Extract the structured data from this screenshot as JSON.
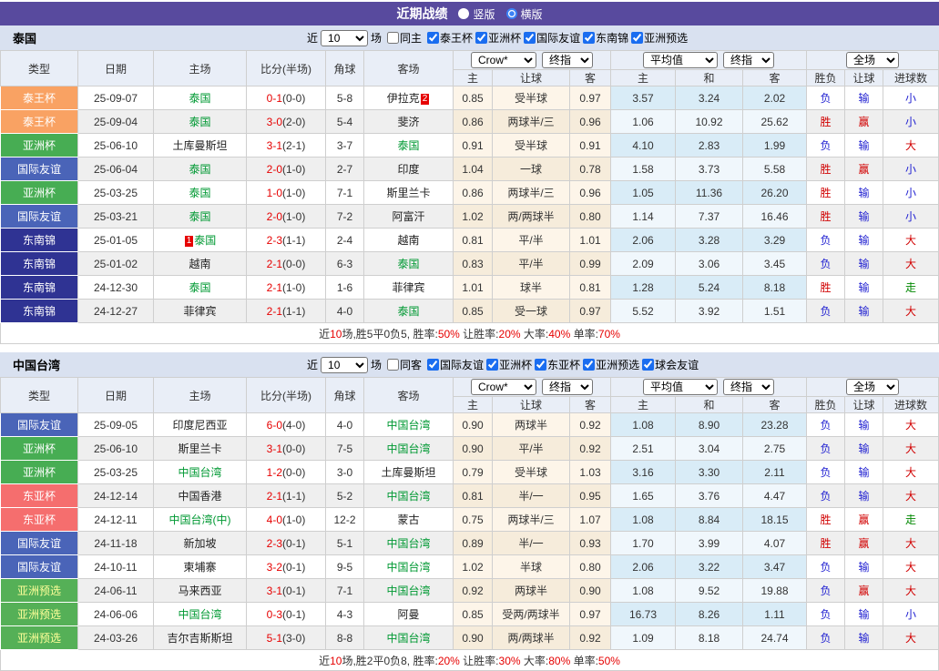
{
  "title_bar": {
    "title": "近期战绩",
    "options": [
      {
        "label": "竖版",
        "selected": false
      },
      {
        "label": "横版",
        "selected": true
      }
    ]
  },
  "table_header": {
    "left_cols": [
      "类型",
      "日期",
      "主场",
      "比分(半场)",
      "角球",
      "客场"
    ],
    "sub_cols": [
      "主",
      "让球",
      "客",
      "主",
      "和",
      "客",
      "胜负",
      "让球",
      "进球数"
    ],
    "odds_group": {
      "source_select": "Crow*",
      "time_select": "终指"
    },
    "avg_group": {
      "source_select": "平均值",
      "time_select": "终指"
    },
    "result_group": {
      "scope_select": "全场"
    }
  },
  "type_styles": {
    "泰王杯": {
      "bg": "#f9a263",
      "fg": "#ffffff"
    },
    "亚洲杯": {
      "bg": "#47ad53",
      "fg": "#ffffff"
    },
    "国际友谊": {
      "bg": "#4a64b8",
      "fg": "#ffffff"
    },
    "东南锦": {
      "bg": "#2f3393",
      "fg": "#ffffff"
    },
    "东亚杯": {
      "bg": "#f56e6e",
      "fg": "#ffffff"
    },
    "亚洲预选": {
      "bg": "#55b057",
      "fg": "#ffff99"
    }
  },
  "result_colors": {
    "胜": "#d10000",
    "负": "#1f1fd1",
    "赢": "#d10000",
    "输": "#1f1fd1",
    "大": "#d10000",
    "小": "#1f1fd1",
    "走": "#008800"
  },
  "sections": [
    {
      "team": "泰国",
      "filter": {
        "near_label": "近",
        "count": "10",
        "games_label": "场",
        "same_label": "同主",
        "same_checked": false,
        "competitions": [
          {
            "label": "泰王杯",
            "checked": true
          },
          {
            "label": "亚洲杯",
            "checked": true
          },
          {
            "label": "国际友谊",
            "checked": true
          },
          {
            "label": "东南锦",
            "checked": true
          },
          {
            "label": "亚洲预选",
            "checked": true
          }
        ]
      },
      "rows": [
        {
          "type": "泰王杯",
          "date": "25-09-07",
          "home": {
            "name": "泰国",
            "green": true
          },
          "score": "0-1",
          "half": "(0-0)",
          "corners": "5-8",
          "away": {
            "name": "伊拉克",
            "green": false,
            "badge": "2",
            "badge_pos": "after"
          },
          "odds": {
            "home": "0.85",
            "line": "受半球",
            "away": "0.97"
          },
          "avg": {
            "home": "3.57",
            "draw": "3.24",
            "away": "2.02"
          },
          "result": {
            "outcome": "负",
            "handicap": "输",
            "goals": "小"
          }
        },
        {
          "type": "泰王杯",
          "date": "25-09-04",
          "home": {
            "name": "泰国",
            "green": true
          },
          "score": "3-0",
          "half": "(2-0)",
          "corners": "5-4",
          "away": {
            "name": "斐济",
            "green": false
          },
          "odds": {
            "home": "0.86",
            "line": "两球半/三",
            "away": "0.96"
          },
          "avg": {
            "home": "1.06",
            "draw": "10.92",
            "away": "25.62"
          },
          "result": {
            "outcome": "胜",
            "handicap": "赢",
            "goals": "小"
          }
        },
        {
          "type": "亚洲杯",
          "date": "25-06-10",
          "home": {
            "name": "土库曼斯坦",
            "green": false
          },
          "score": "3-1",
          "half": "(2-1)",
          "corners": "3-7",
          "away": {
            "name": "泰国",
            "green": true
          },
          "odds": {
            "home": "0.91",
            "line": "受半球",
            "away": "0.91"
          },
          "avg": {
            "home": "4.10",
            "draw": "2.83",
            "away": "1.99"
          },
          "result": {
            "outcome": "负",
            "handicap": "输",
            "goals": "大"
          }
        },
        {
          "type": "国际友谊",
          "date": "25-06-04",
          "home": {
            "name": "泰国",
            "green": true
          },
          "score": "2-0",
          "half": "(1-0)",
          "corners": "2-7",
          "away": {
            "name": "印度",
            "green": false
          },
          "odds": {
            "home": "1.04",
            "line": "一球",
            "away": "0.78"
          },
          "avg": {
            "home": "1.58",
            "draw": "3.73",
            "away": "5.58"
          },
          "result": {
            "outcome": "胜",
            "handicap": "赢",
            "goals": "小"
          }
        },
        {
          "type": "亚洲杯",
          "date": "25-03-25",
          "home": {
            "name": "泰国",
            "green": true
          },
          "score": "1-0",
          "half": "(1-0)",
          "corners": "7-1",
          "away": {
            "name": "斯里兰卡",
            "green": false
          },
          "odds": {
            "home": "0.86",
            "line": "两球半/三",
            "away": "0.96"
          },
          "avg": {
            "home": "1.05",
            "draw": "11.36",
            "away": "26.20"
          },
          "result": {
            "outcome": "胜",
            "handicap": "输",
            "goals": "小"
          }
        },
        {
          "type": "国际友谊",
          "date": "25-03-21",
          "home": {
            "name": "泰国",
            "green": true
          },
          "score": "2-0",
          "half": "(1-0)",
          "corners": "7-2",
          "away": {
            "name": "阿富汗",
            "green": false
          },
          "odds": {
            "home": "1.02",
            "line": "两/两球半",
            "away": "0.80"
          },
          "avg": {
            "home": "1.14",
            "draw": "7.37",
            "away": "16.46"
          },
          "result": {
            "outcome": "胜",
            "handicap": "输",
            "goals": "小"
          }
        },
        {
          "type": "东南锦",
          "date": "25-01-05",
          "home": {
            "name": "泰国",
            "green": true,
            "badge": "1",
            "badge_pos": "before"
          },
          "score": "2-3",
          "half": "(1-1)",
          "corners": "2-4",
          "away": {
            "name": "越南",
            "green": false
          },
          "odds": {
            "home": "0.81",
            "line": "平/半",
            "away": "1.01"
          },
          "avg": {
            "home": "2.06",
            "draw": "3.28",
            "away": "3.29"
          },
          "result": {
            "outcome": "负",
            "handicap": "输",
            "goals": "大"
          }
        },
        {
          "type": "东南锦",
          "date": "25-01-02",
          "home": {
            "name": "越南",
            "green": false
          },
          "score": "2-1",
          "half": "(0-0)",
          "corners": "6-3",
          "away": {
            "name": "泰国",
            "green": true
          },
          "odds": {
            "home": "0.83",
            "line": "平/半",
            "away": "0.99"
          },
          "avg": {
            "home": "2.09",
            "draw": "3.06",
            "away": "3.45"
          },
          "result": {
            "outcome": "负",
            "handicap": "输",
            "goals": "大"
          }
        },
        {
          "type": "东南锦",
          "date": "24-12-30",
          "home": {
            "name": "泰国",
            "green": true
          },
          "score": "2-1",
          "half": "(1-0)",
          "corners": "1-6",
          "away": {
            "name": "菲律宾",
            "green": false
          },
          "odds": {
            "home": "1.01",
            "line": "球半",
            "away": "0.81"
          },
          "avg": {
            "home": "1.28",
            "draw": "5.24",
            "away": "8.18"
          },
          "result": {
            "outcome": "胜",
            "handicap": "输",
            "goals": "走"
          }
        },
        {
          "type": "东南锦",
          "date": "24-12-27",
          "home": {
            "name": "菲律宾",
            "green": false
          },
          "score": "2-1",
          "half": "(1-1)",
          "corners": "4-0",
          "away": {
            "name": "泰国",
            "green": true
          },
          "odds": {
            "home": "0.85",
            "line": "受一球",
            "away": "0.97"
          },
          "avg": {
            "home": "5.52",
            "draw": "3.92",
            "away": "1.51"
          },
          "result": {
            "outcome": "负",
            "handicap": "输",
            "goals": "大"
          }
        }
      ],
      "summary": [
        {
          "text": "近",
          "red": false
        },
        {
          "text": "10",
          "red": true
        },
        {
          "text": "场,胜5平0负5, 胜率:",
          "red": false
        },
        {
          "text": "50%",
          "red": true
        },
        {
          "text": " 让胜率:",
          "red": false
        },
        {
          "text": "20%",
          "red": true
        },
        {
          "text": " 大率:",
          "red": false
        },
        {
          "text": "40%",
          "red": true
        },
        {
          "text": " 单率:",
          "red": false
        },
        {
          "text": "70%",
          "red": true
        }
      ]
    },
    {
      "team": "中国台湾",
      "filter": {
        "near_label": "近",
        "count": "10",
        "games_label": "场",
        "same_label": "同客",
        "same_checked": false,
        "competitions": [
          {
            "label": "国际友谊",
            "checked": true
          },
          {
            "label": "亚洲杯",
            "checked": true
          },
          {
            "label": "东亚杯",
            "checked": true
          },
          {
            "label": "亚洲预选",
            "checked": true
          },
          {
            "label": "球会友谊",
            "checked": true
          }
        ]
      },
      "rows": [
        {
          "type": "国际友谊",
          "date": "25-09-05",
          "home": {
            "name": "印度尼西亚",
            "green": false
          },
          "score": "6-0",
          "half": "(4-0)",
          "corners": "4-0",
          "away": {
            "name": "中国台湾",
            "green": true
          },
          "odds": {
            "home": "0.90",
            "line": "两球半",
            "away": "0.92"
          },
          "avg": {
            "home": "1.08",
            "draw": "8.90",
            "away": "23.28"
          },
          "result": {
            "outcome": "负",
            "handicap": "输",
            "goals": "大"
          }
        },
        {
          "type": "亚洲杯",
          "date": "25-06-10",
          "home": {
            "name": "斯里兰卡",
            "green": false
          },
          "score": "3-1",
          "half": "(0-0)",
          "corners": "7-5",
          "away": {
            "name": "中国台湾",
            "green": true
          },
          "odds": {
            "home": "0.90",
            "line": "平/半",
            "away": "0.92"
          },
          "avg": {
            "home": "2.51",
            "draw": "3.04",
            "away": "2.75"
          },
          "result": {
            "outcome": "负",
            "handicap": "输",
            "goals": "大"
          }
        },
        {
          "type": "亚洲杯",
          "date": "25-03-25",
          "home": {
            "name": "中国台湾",
            "green": true
          },
          "score": "1-2",
          "half": "(0-0)",
          "corners": "3-0",
          "away": {
            "name": "土库曼斯坦",
            "green": false
          },
          "odds": {
            "home": "0.79",
            "line": "受半球",
            "away": "1.03"
          },
          "avg": {
            "home": "3.16",
            "draw": "3.30",
            "away": "2.11"
          },
          "result": {
            "outcome": "负",
            "handicap": "输",
            "goals": "大"
          }
        },
        {
          "type": "东亚杯",
          "date": "24-12-14",
          "home": {
            "name": "中国香港",
            "green": false
          },
          "score": "2-1",
          "half": "(1-1)",
          "corners": "5-2",
          "away": {
            "name": "中国台湾",
            "green": true
          },
          "odds": {
            "home": "0.81",
            "line": "半/一",
            "away": "0.95"
          },
          "avg": {
            "home": "1.65",
            "draw": "3.76",
            "away": "4.47"
          },
          "result": {
            "outcome": "负",
            "handicap": "输",
            "goals": "大"
          }
        },
        {
          "type": "东亚杯",
          "date": "24-12-11",
          "home": {
            "name": "中国台湾(中)",
            "green": true
          },
          "score": "4-0",
          "half": "(1-0)",
          "corners": "12-2",
          "away": {
            "name": "蒙古",
            "green": false
          },
          "odds": {
            "home": "0.75",
            "line": "两球半/三",
            "away": "1.07"
          },
          "avg": {
            "home": "1.08",
            "draw": "8.84",
            "away": "18.15"
          },
          "result": {
            "outcome": "胜",
            "handicap": "赢",
            "goals": "走"
          }
        },
        {
          "type": "国际友谊",
          "date": "24-11-18",
          "home": {
            "name": "新加坡",
            "green": false
          },
          "score": "2-3",
          "half": "(0-1)",
          "corners": "5-1",
          "away": {
            "name": "中国台湾",
            "green": true
          },
          "odds": {
            "home": "0.89",
            "line": "半/一",
            "away": "0.93"
          },
          "avg": {
            "home": "1.70",
            "draw": "3.99",
            "away": "4.07"
          },
          "result": {
            "outcome": "胜",
            "handicap": "赢",
            "goals": "大"
          }
        },
        {
          "type": "国际友谊",
          "date": "24-10-11",
          "home": {
            "name": "柬埔寨",
            "green": false
          },
          "score": "3-2",
          "half": "(0-1)",
          "corners": "9-5",
          "away": {
            "name": "中国台湾",
            "green": true
          },
          "odds": {
            "home": "1.02",
            "line": "半球",
            "away": "0.80"
          },
          "avg": {
            "home": "2.06",
            "draw": "3.22",
            "away": "3.47"
          },
          "result": {
            "outcome": "负",
            "handicap": "输",
            "goals": "大"
          }
        },
        {
          "type": "亚洲预选",
          "date": "24-06-11",
          "home": {
            "name": "马来西亚",
            "green": false
          },
          "score": "3-1",
          "half": "(0-1)",
          "corners": "7-1",
          "away": {
            "name": "中国台湾",
            "green": true
          },
          "odds": {
            "home": "0.92",
            "line": "两球半",
            "away": "0.90"
          },
          "avg": {
            "home": "1.08",
            "draw": "9.52",
            "away": "19.88"
          },
          "result": {
            "outcome": "负",
            "handicap": "赢",
            "goals": "大"
          }
        },
        {
          "type": "亚洲预选",
          "date": "24-06-06",
          "home": {
            "name": "中国台湾",
            "green": true
          },
          "score": "0-3",
          "half": "(0-1)",
          "corners": "4-3",
          "away": {
            "name": "阿曼",
            "green": false
          },
          "odds": {
            "home": "0.85",
            "line": "受两/两球半",
            "away": "0.97"
          },
          "avg": {
            "home": "16.73",
            "draw": "8.26",
            "away": "1.11"
          },
          "result": {
            "outcome": "负",
            "handicap": "输",
            "goals": "小"
          }
        },
        {
          "type": "亚洲预选",
          "date": "24-03-26",
          "home": {
            "name": "吉尔吉斯斯坦",
            "green": false
          },
          "score": "5-1",
          "half": "(3-0)",
          "corners": "8-8",
          "away": {
            "name": "中国台湾",
            "green": true
          },
          "odds": {
            "home": "0.90",
            "line": "两/两球半",
            "away": "0.92"
          },
          "avg": {
            "home": "1.09",
            "draw": "8.18",
            "away": "24.74"
          },
          "result": {
            "outcome": "负",
            "handicap": "输",
            "goals": "大"
          }
        }
      ],
      "summary": [
        {
          "text": "近",
          "red": false
        },
        {
          "text": "10",
          "red": true
        },
        {
          "text": "场,胜2平0负8, 胜率:",
          "red": false
        },
        {
          "text": "20%",
          "red": true
        },
        {
          "text": " 让胜率:",
          "red": false
        },
        {
          "text": "30%",
          "red": true
        },
        {
          "text": " 大率:",
          "red": false
        },
        {
          "text": "80%",
          "red": true
        },
        {
          "text": " 单率:",
          "red": false
        },
        {
          "text": "50%",
          "red": true
        }
      ]
    }
  ]
}
